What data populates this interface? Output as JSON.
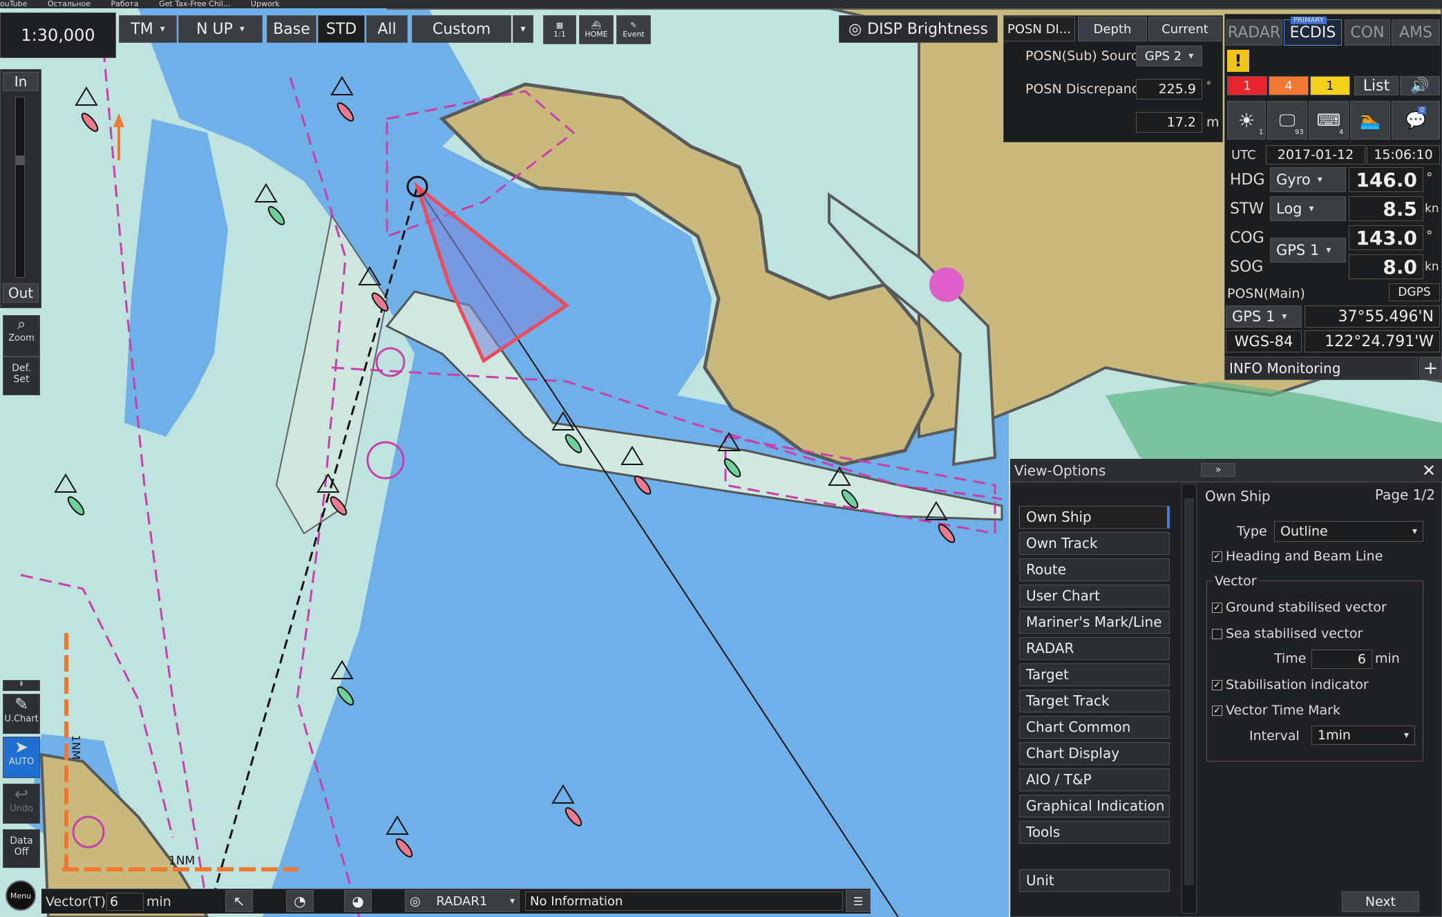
{
  "bookmarks": [
    "ouTube",
    "Остальное",
    "Работа",
    "Get Tax-Free Chil...",
    "Upwork"
  ],
  "scale": "1:30,000",
  "toolbar": {
    "tm": "TM",
    "nup": "N UP",
    "base": "Base",
    "std": "STD",
    "all": "All",
    "custom": "Custom",
    "btn1": "1:1",
    "home": "HOME",
    "event": "Event",
    "brightness": "DISP Brightness"
  },
  "zoom": {
    "in": "In",
    "out": "Out",
    "zoom": "Zoom",
    "def": "Def.\nSet",
    "uchart": "U.Chart",
    "auto": "AUTO",
    "undo": "Undo",
    "dataoff": "Data\nOff",
    "menu": "Menu"
  },
  "posn_tabs": {
    "t1": "POSN DI...",
    "t2": "Depth",
    "t3": "Current"
  },
  "posn": {
    "source_label": "POSN(Sub) Source",
    "source_value": "GPS 2",
    "disc_label": "POSN Discrepancy",
    "disc_value": "225.9",
    "disc_unit": "°",
    "disc_m": "17.2",
    "m_unit": "m"
  },
  "mode_tabs": {
    "radar": "RADAR",
    "ecdis": "ECDIS",
    "primary": "PRIMARY",
    "con": "CON",
    "ams": "AMS"
  },
  "alerts": {
    "red": "1",
    "orange": "4",
    "yellow": "1",
    "list": "List"
  },
  "icons_row": {
    "a": "1",
    "b": "93",
    "c": "4",
    "d": "0"
  },
  "utc": {
    "label": "UTC",
    "date": "2017-01-12",
    "time": "15:06:10"
  },
  "nav": {
    "hdg": "HDG",
    "hdg_src": "Gyro",
    "hdg_val": "146.0",
    "deg": "°",
    "stw": "STW",
    "stw_src": "Log",
    "stw_val": "8.5",
    "kn": "kn",
    "cog": "COG",
    "cog_val": "143.0",
    "sog": "SOG",
    "gps_src": "GPS 1",
    "sog_val": "8.0",
    "posn_main": "POSN(Main)",
    "dgps": "DGPS",
    "posn_src": "GPS 1",
    "lat": "37°55.496'N",
    "datum": "WGS-84",
    "lon": "122°24.791'W",
    "info": "INFO Monitoring"
  },
  "view": {
    "title": "View-Options",
    "arrow": "»",
    "items": [
      "Own Ship",
      "Own Track",
      "Route",
      "User Chart",
      "Mariner's Mark/Line",
      "RADAR",
      "Target",
      "Target Track",
      "Chart Common",
      "Chart Display",
      "AIO / T&P",
      "Graphical Indication",
      "Tools"
    ],
    "unit": "Unit",
    "right_title": "Own Ship",
    "page": "Page 1/2",
    "type_label": "Type",
    "type_value": "Outline",
    "heading_beam": "Heading and Beam Line",
    "vector": "Vector",
    "ground": "Ground stabilised vector",
    "sea": "Sea stabilised vector",
    "time_label": "Time",
    "time_value": "6",
    "min": "min",
    "stab": "Stabilisation indicator",
    "vtm": "Vector Time Mark",
    "interval_label": "Interval",
    "interval_value": "1min",
    "next": "Next"
  },
  "bottom": {
    "vector": "Vector(T)",
    "vector_val": "6",
    "min": "min",
    "radar": "RADAR1",
    "info": "No Information"
  },
  "chart_labels": {
    "scale_bar": "1NM",
    "vscale": "1NM"
  }
}
